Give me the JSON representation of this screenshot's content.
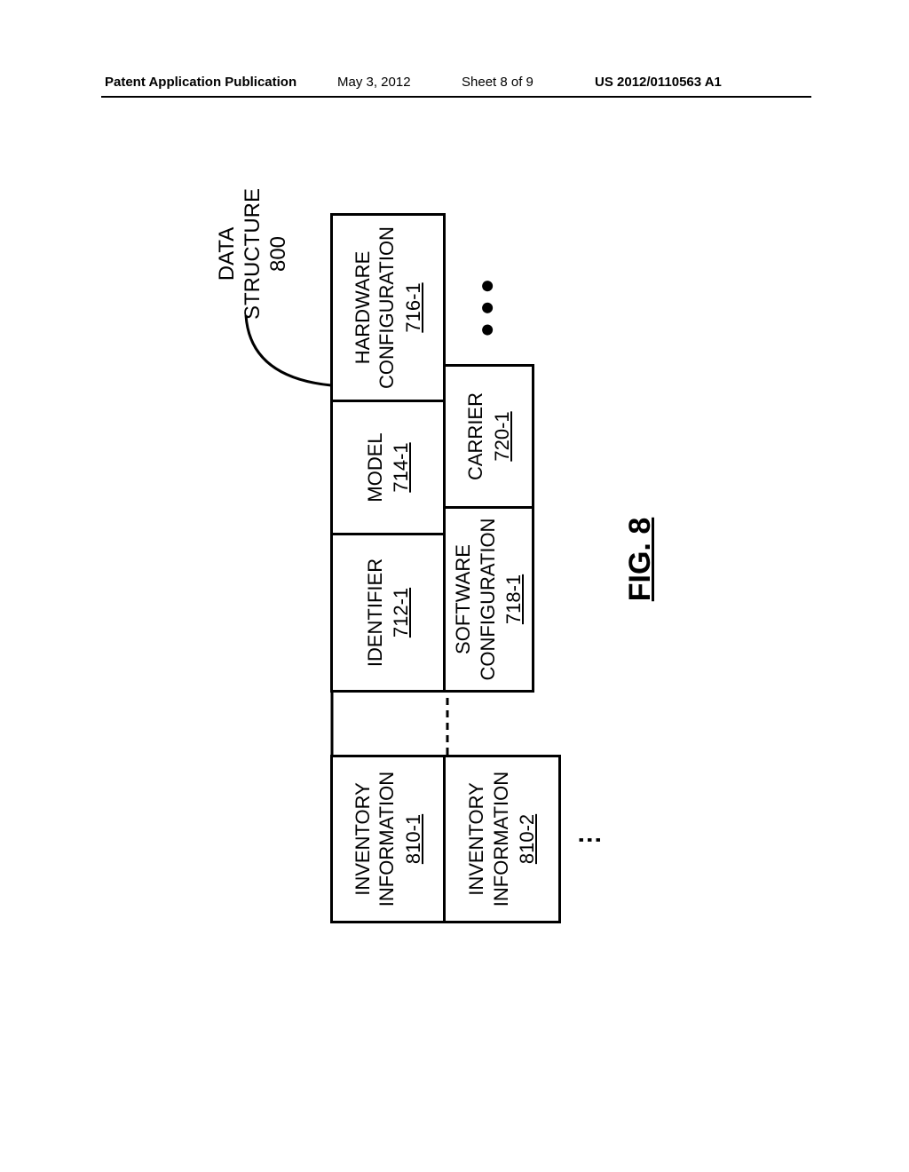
{
  "header": {
    "left": "Patent Application Publication",
    "date": "May 3, 2012",
    "sheet": "Sheet 8 of 9",
    "pubno": "US 2012/0110563 A1"
  },
  "callout": {
    "line1": "DATA",
    "line2": "STRUCTURE",
    "line3": "800"
  },
  "inventory": [
    {
      "label": "INVENTORY\nINFORMATION",
      "ref": "810-1"
    },
    {
      "label": "INVENTORY\nINFORMATION",
      "ref": "810-2"
    }
  ],
  "ellipsis_v": "⋮",
  "cells": {
    "identifier": {
      "label": "IDENTIFIER",
      "ref": "712-1"
    },
    "model": {
      "label": "MODEL",
      "ref": "714-1"
    },
    "hardware": {
      "label": "HARDWARE\nCONFIGURATION",
      "ref": "716-1"
    },
    "software": {
      "label": "SOFTWARE\nCONFIGURATION",
      "ref": "718-1"
    },
    "carrier": {
      "label": "CARRIER",
      "ref": "720-1"
    }
  },
  "cells_ellipsis": "● ● ●",
  "figure_caption": "FIG. 8"
}
